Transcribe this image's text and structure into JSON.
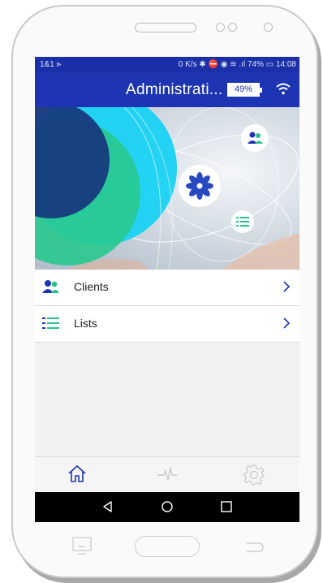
{
  "status_bar": {
    "carrier": "1&1 ⪢",
    "indicators": "0 K/s ✱ ⛔ ◉ ≋ .ıl 74% ▭ 14:08"
  },
  "app_bar": {
    "title": "Administrati...",
    "battery_label": "49%"
  },
  "menu": {
    "items": [
      {
        "label": "Clients",
        "icon": "clients-icon"
      },
      {
        "label": "Lists",
        "icon": "list-icon"
      }
    ]
  },
  "tab_bar": {
    "items": [
      {
        "icon": "home-icon",
        "active": true
      },
      {
        "icon": "activity-icon",
        "active": false
      },
      {
        "icon": "settings-icon",
        "active": false
      }
    ]
  },
  "colors": {
    "primary": "#1d35b2",
    "accent_green": "#27c08a",
    "accent_cyan": "#19c4ee"
  }
}
